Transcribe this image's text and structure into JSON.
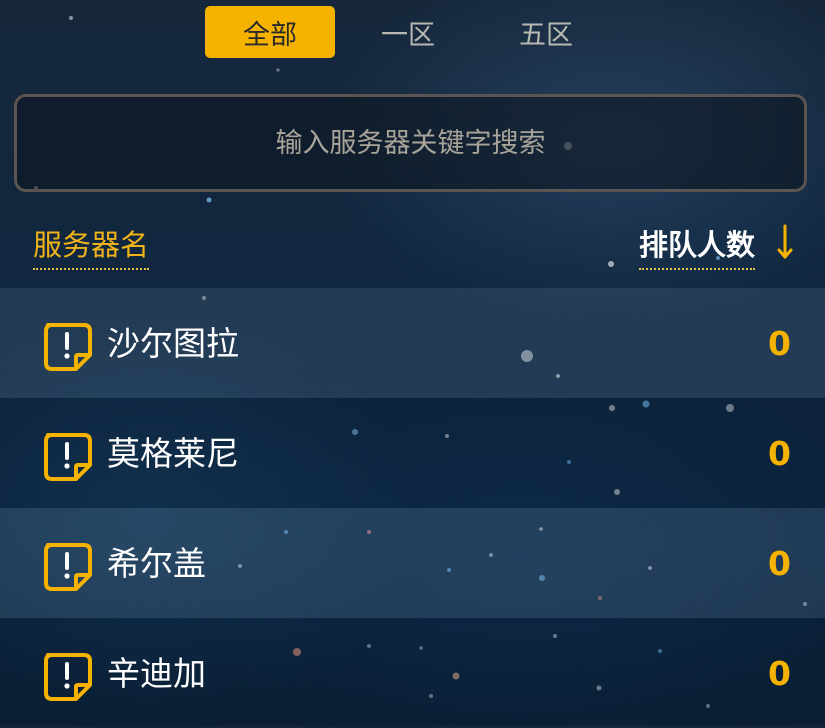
{
  "tabs": [
    {
      "label": "全部",
      "active": true
    },
    {
      "label": "一区",
      "active": false
    },
    {
      "label": "五区",
      "active": false
    }
  ],
  "search": {
    "placeholder": "输入服务器关键字搜索",
    "value": ""
  },
  "header": {
    "server_name_label": "服务器名",
    "queue_label": "排队人数",
    "sort_icon": "arrow-down-icon"
  },
  "servers": [
    {
      "name": "沙尔图拉",
      "count": "0",
      "icon": "alert-note-icon"
    },
    {
      "name": "莫格莱尼",
      "count": "0",
      "icon": "alert-note-icon"
    },
    {
      "name": "希尔盖",
      "count": "0",
      "icon": "alert-note-icon"
    },
    {
      "name": "辛迪加",
      "count": "0",
      "icon": "alert-note-icon"
    }
  ],
  "colors": {
    "accent": "#f5b300",
    "header_accent": "#f0b31a",
    "background": "#0f2740"
  }
}
